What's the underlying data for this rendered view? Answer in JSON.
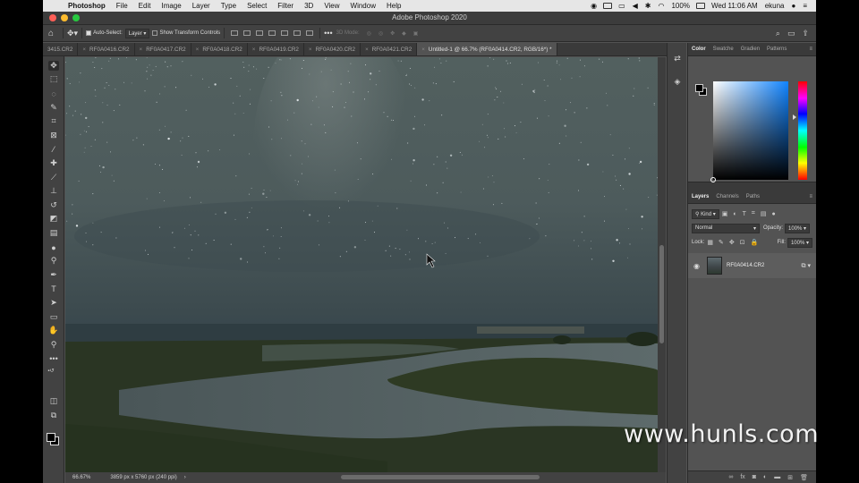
{
  "menubar": {
    "app": "Photoshop",
    "items": [
      "File",
      "Edit",
      "Image",
      "Layer",
      "Type",
      "Select",
      "Filter",
      "3D",
      "View",
      "Window",
      "Help"
    ],
    "battery": "100%",
    "clock": "Wed 11:06 AM",
    "user": "ekuna"
  },
  "window": {
    "title": "Adobe Photoshop 2020"
  },
  "options": {
    "auto_select_label": "Auto-Select:",
    "auto_select_value": "Layer",
    "show_transform_label": "Show Transform Controls",
    "mode_label": "3D Mode:"
  },
  "tabs": [
    {
      "label": "3415.CR2"
    },
    {
      "label": "RF0A0416.CR2"
    },
    {
      "label": "RF0A0417.CR2"
    },
    {
      "label": "RF0A0418.CR2"
    },
    {
      "label": "RF0A0419.CR2"
    },
    {
      "label": "RF0A0420.CR2"
    },
    {
      "label": "RF0A0421.CR2"
    },
    {
      "label": "Untitled-1 @ 66.7% (RF0A0414.CR2, RGB/16*) *"
    }
  ],
  "status": {
    "zoom": "66.67%",
    "doc_info": "3859 px x 5760 px (240 ppi)",
    "arrow": "›"
  },
  "color_panel": {
    "tabs": [
      "Color",
      "Swatche",
      "Gradien",
      "Patterns"
    ],
    "foreground": "#000000",
    "background": "#000000",
    "hue_color": "#1184ff"
  },
  "layers_panel": {
    "tabs": [
      "Layers",
      "Channels",
      "Paths"
    ],
    "kind_label": "Kind",
    "blend_mode": "Normal",
    "opacity_label": "Opacity:",
    "opacity_value": "100%",
    "lock_label": "Lock:",
    "fill_label": "Fill:",
    "fill_value": "100%",
    "layers": [
      {
        "name": "RF0A0414.CR2",
        "visible": true,
        "smart_object": true
      }
    ]
  },
  "watermark": "www.hunls.com"
}
